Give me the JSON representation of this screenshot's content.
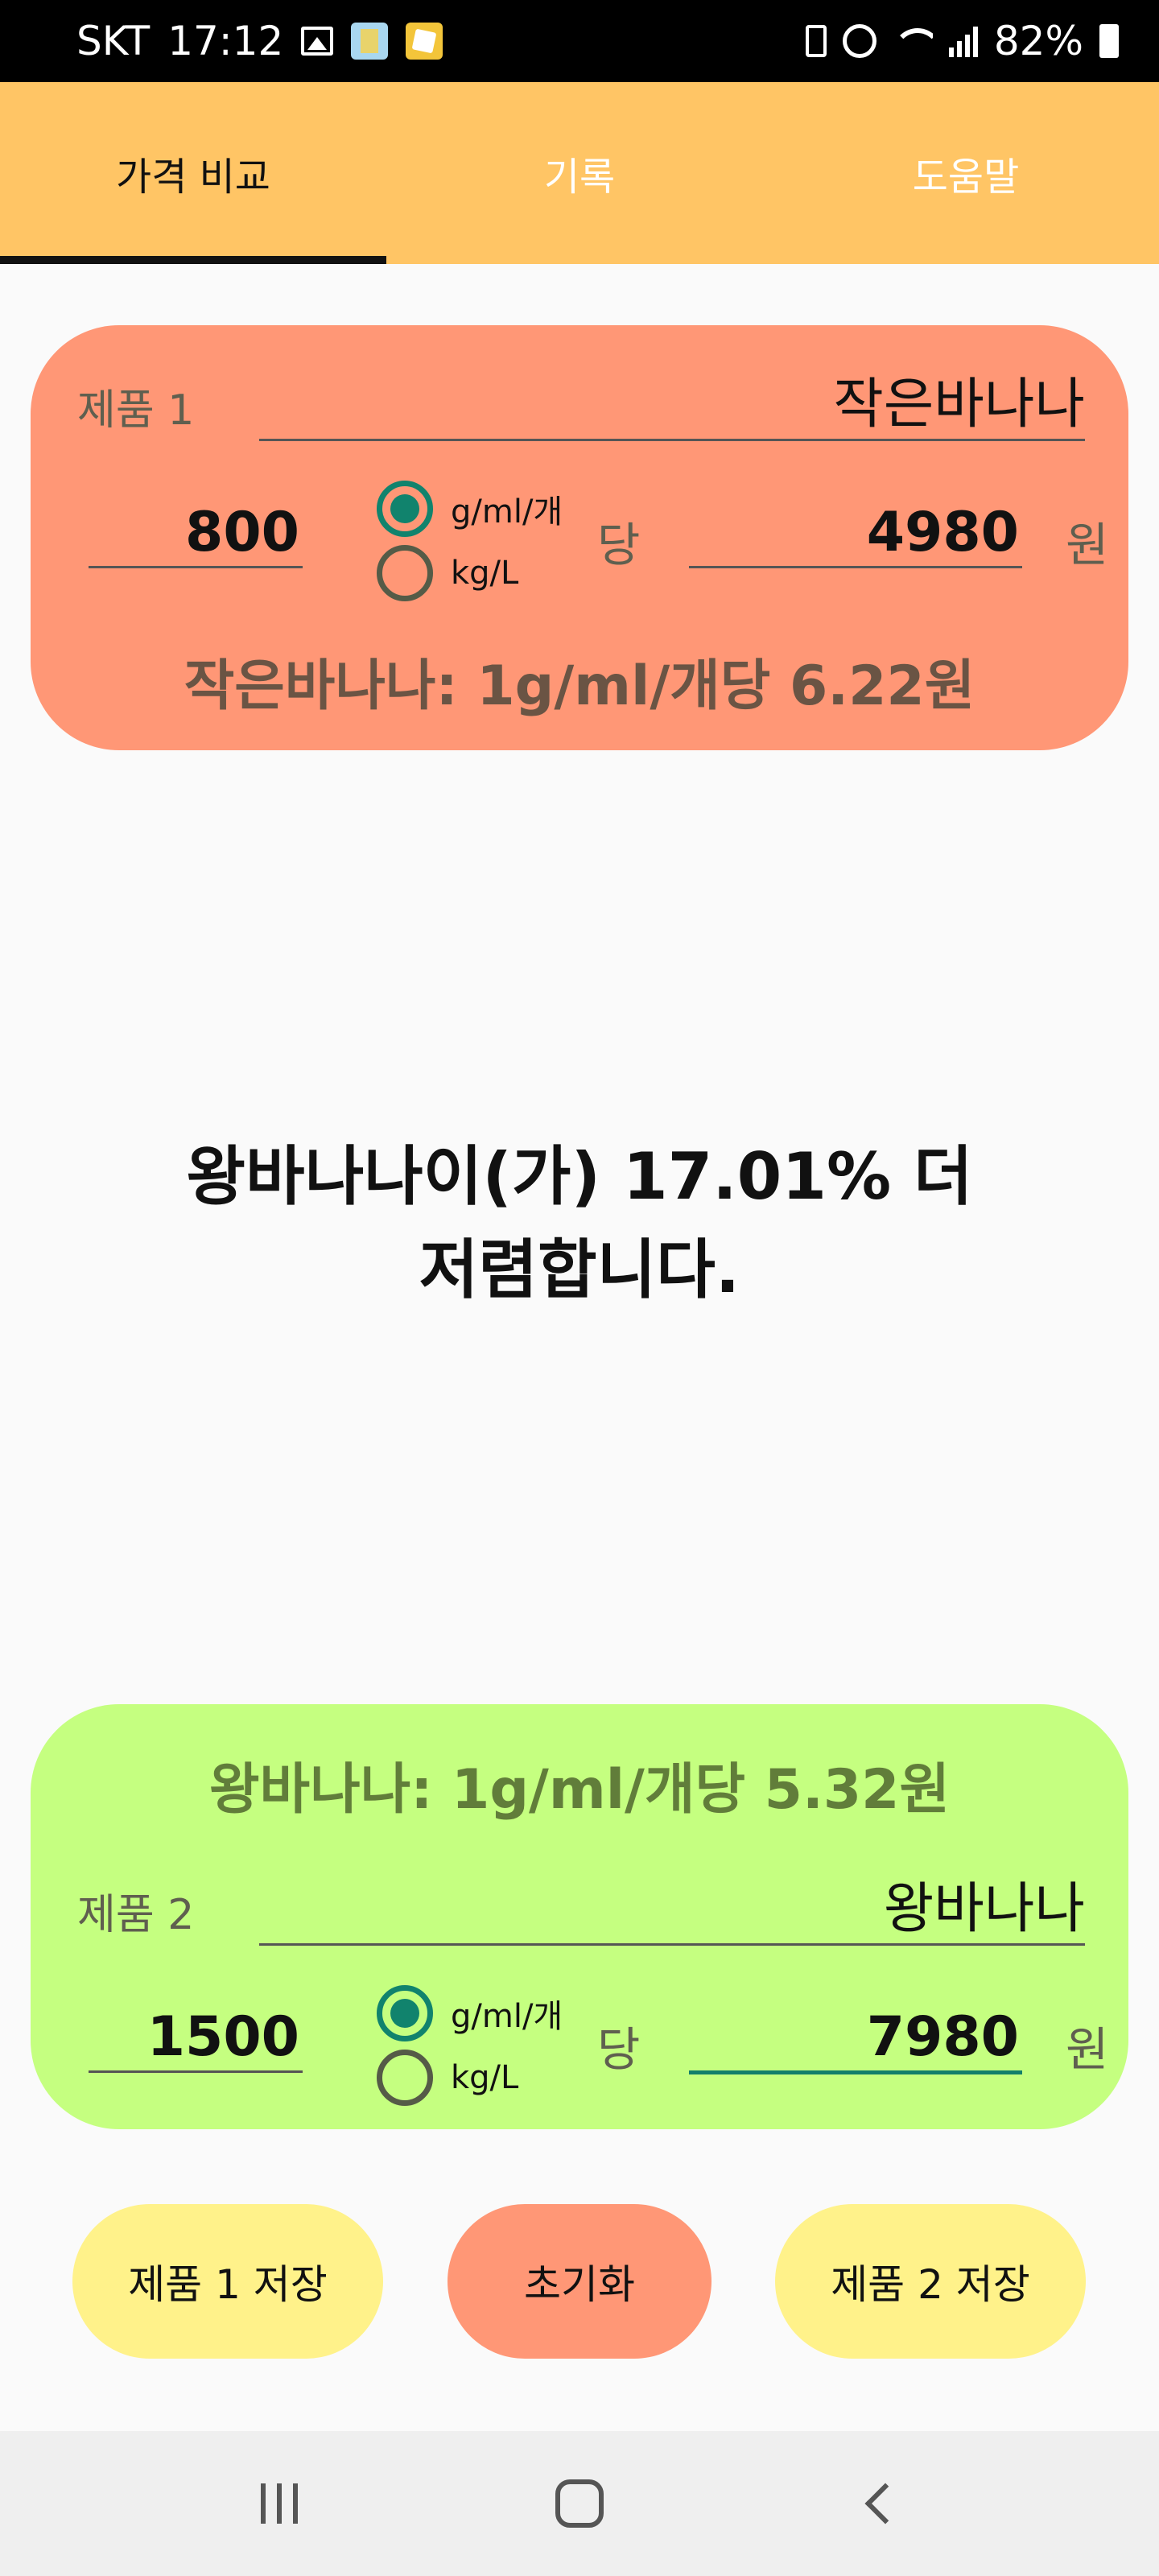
{
  "status_bar": {
    "carrier": "SKT",
    "time": "17:12",
    "battery": "82%"
  },
  "tabs": [
    {
      "label": "가격 비교",
      "active": true
    },
    {
      "label": "기록",
      "active": false
    },
    {
      "label": "도움말",
      "active": false
    }
  ],
  "product1": {
    "label": "제품 1",
    "name": "작은바나나",
    "quantity": "800",
    "unit_options": [
      "g/ml/개",
      "kg/L"
    ],
    "selected_unit": "g/ml/개",
    "per": "당",
    "price": "4980",
    "currency": "원",
    "unit_price_text": "작은바나나: 1g/ml/개당 6.22원"
  },
  "result": {
    "line1": "왕바나나이(가) 17.01% 더",
    "line2": "저렴합니다."
  },
  "product2": {
    "label": "제품 2",
    "name": "왕바나나",
    "quantity": "1500",
    "unit_options": [
      "g/ml/개",
      "kg/L"
    ],
    "selected_unit": "g/ml/개",
    "per": "당",
    "price": "7980",
    "currency": "원",
    "unit_price_text": "왕바나나: 1g/ml/개당 5.32원"
  },
  "buttons": {
    "save1": "제품 1 저장",
    "reset": "초기화",
    "save2": "제품 2 저장"
  },
  "colors": {
    "tab_bar": "#ffc565",
    "card1": "#ff9776",
    "card2": "#c5ff80",
    "save_button": "#fff28a",
    "reset_button": "#ff9776",
    "accent": "#11836d"
  }
}
